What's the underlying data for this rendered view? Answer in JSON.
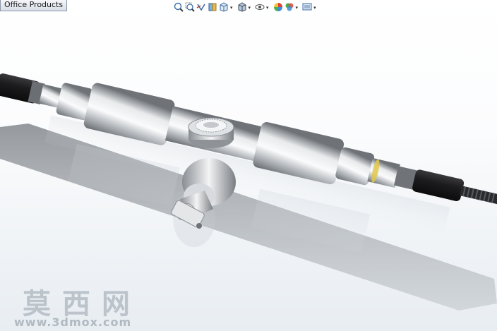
{
  "app": {
    "tab_label": "Office Products"
  },
  "toolbar": {
    "buttons": [
      {
        "icon": "zoom-to-fit-icon",
        "has_dropdown": false
      },
      {
        "icon": "zoom-to-area-icon",
        "has_dropdown": false
      },
      {
        "icon": "previous-view-icon",
        "has_dropdown": false
      },
      {
        "icon": "section-view-icon",
        "has_dropdown": false
      },
      {
        "icon": "view-orientation-icon",
        "has_dropdown": true
      },
      {
        "icon": "display-style-icon",
        "has_dropdown": true
      },
      {
        "icon": "hide-show-items-icon",
        "has_dropdown": true
      },
      {
        "icon": "edit-appearance-icon",
        "has_dropdown": false
      },
      {
        "icon": "apply-scene-icon",
        "has_dropdown": true
      },
      {
        "icon": "view-settings-icon",
        "has_dropdown": true
      }
    ]
  },
  "watermark": {
    "site_name": "莫西网",
    "url": "www.3dmox.com"
  },
  "colors": {
    "viewport_top": "#ffffff",
    "viewport_bottom": "#e8edf2",
    "metal": "#b8bcc0",
    "rubber": "#1c1c1e"
  }
}
